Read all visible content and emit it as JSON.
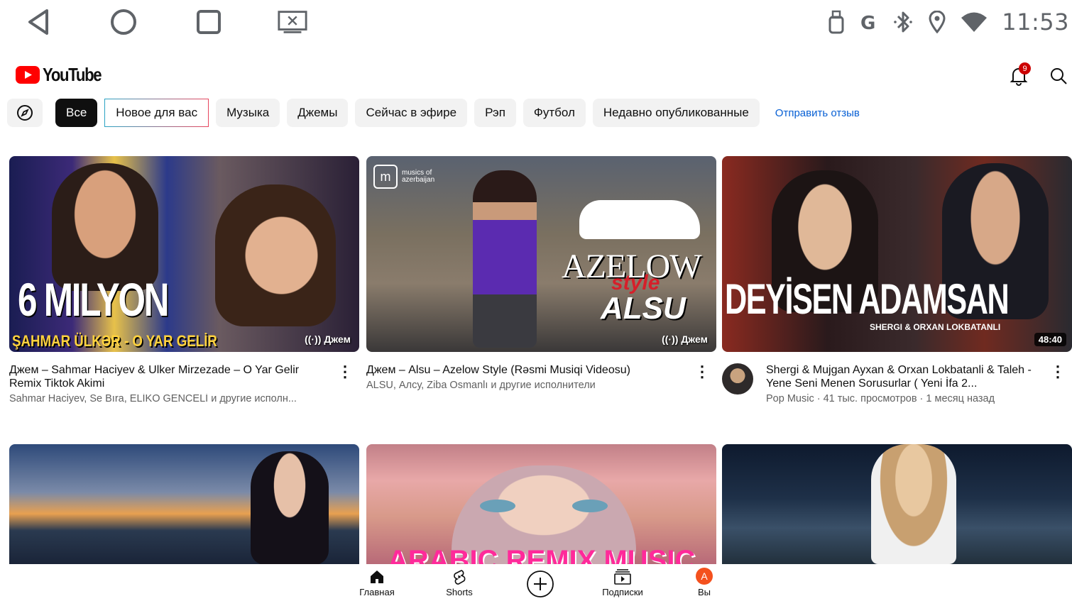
{
  "system_bar": {
    "clock": "11:53",
    "nav_icons": [
      "back-icon",
      "home-icon",
      "recents-icon",
      "screen-cast-icon"
    ],
    "status_icons": [
      "usb-icon",
      "google-g-icon",
      "bluetooth-icon",
      "location-icon",
      "wifi-icon"
    ]
  },
  "header": {
    "logo_text": "YouTube",
    "notification_count": "9",
    "icons": [
      "notifications-icon",
      "search-icon"
    ]
  },
  "chips": {
    "explore_icon": "compass-icon",
    "items": [
      "Все",
      "Новое для вас",
      "Музыка",
      "Джемы",
      "Сейчас в эфире",
      "Рэп",
      "Футбол",
      "Недавно опубликованные"
    ],
    "active_index": 0,
    "feedback": "Отправить отзыв"
  },
  "videos": [
    {
      "thumb_text": "6 MILYON",
      "thumb_caption": "ŞAHMAR ÜLKƏR - O YAR GELİR",
      "thumb_tag": "Джем",
      "title": "Джем – Sahmar Haciyev & Ulker Mirzezade – O Yar Gelir Remix Tiktok Akimi",
      "subtitle": "Sahmar Haciyev, Se Bıra, ELİKO GENCELİ и другие исполн..."
    },
    {
      "thumb_logo": "musics of azerbaijan",
      "thumb_text": "AZELOW",
      "thumb_text2": "style",
      "thumb_text3": "ALSU",
      "thumb_tag": "Джем",
      "title": "Джем – Alsu – Azelow Style (Rəsmi Musiqi Videosu)",
      "subtitle": "ALSU, Алсу, Ziba Osmanlı и другие исполнители"
    },
    {
      "thumb_text": "DEYİSEN ADAMSAN",
      "thumb_caption": "SHERGI & ORXAN LOKBATANLI",
      "duration": "48:40",
      "title": "Shergi & Mujgan Ayxan & Orxan Lokbatanli & Taleh - Yene Seni Menen Sorusurlar ( Yeni İfa 2...",
      "subtitle": "Pop Music · 41 тыс. просмотров · 1 месяц назад"
    },
    {
      "thumb_text": ""
    },
    {
      "thumb_text": "ARABIC REMIX MUSIC"
    },
    {
      "thumb_text": ""
    }
  ],
  "bottom_nav": [
    {
      "label": "Главная",
      "icon": "home-filled-icon"
    },
    {
      "label": "Shorts",
      "icon": "shorts-icon"
    },
    {
      "label": "",
      "icon": "create-plus-icon"
    },
    {
      "label": "Подписки",
      "icon": "subscriptions-icon"
    },
    {
      "label": "Вы",
      "icon": "account-avatar",
      "avatar_letter": "A"
    }
  ]
}
